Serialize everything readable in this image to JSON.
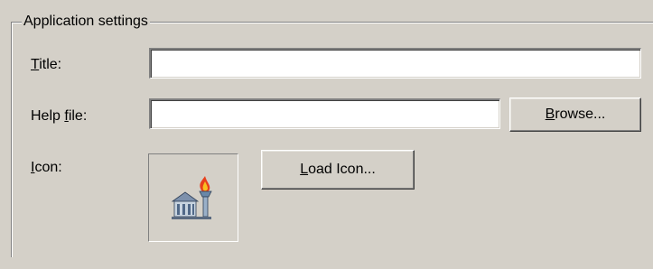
{
  "group": {
    "title": "Application settings"
  },
  "title_field": {
    "label_mnemonic": "T",
    "label_rest": "itle:",
    "value": ""
  },
  "help_file_field": {
    "label_before": "Help ",
    "label_mnemonic": "f",
    "label_after": "ile:",
    "value": ""
  },
  "browse_button": {
    "mnemonic": "B",
    "rest": "rowse..."
  },
  "icon_field": {
    "label_mnemonic": "I",
    "label_rest": "con:"
  },
  "load_icon_button": {
    "mnemonic": "L",
    "rest": "oad Icon..."
  },
  "icons": {
    "app_icon": "torch-building-icon"
  },
  "colors": {
    "dialog_background": "#d4d0c8",
    "field_background": "#ffffff"
  }
}
